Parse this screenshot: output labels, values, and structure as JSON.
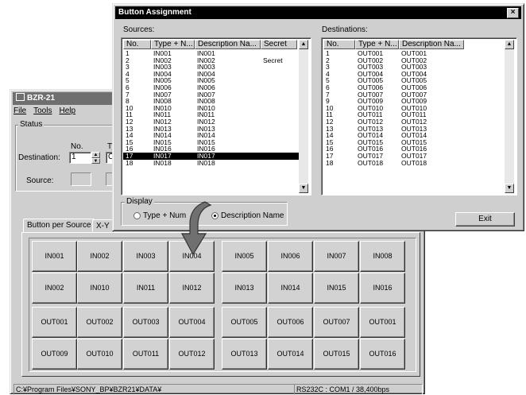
{
  "main_window": {
    "title": "BZR-21",
    "menu": [
      "File",
      "Tools",
      "Help"
    ],
    "status_group_label": "Status",
    "no_label": "No.",
    "type_label_partial": "Ty",
    "destination_label": "Destination:",
    "destination_value": "1",
    "type_value_partial": "C",
    "source_label": "Source:",
    "tabs": [
      "Button per Source",
      "X-Y"
    ],
    "button_rows": [
      [
        "IN001",
        "IN002",
        "IN003",
        "IN004",
        "IN005",
        "IN006",
        "IN007",
        "IN008"
      ],
      [
        "IN002",
        "IN010",
        "IN011",
        "IN012",
        "IN013",
        "IN014",
        "IN015",
        "IN016"
      ],
      [
        "OUT001",
        "OUT002",
        "OUT003",
        "OUT004",
        "OUT005",
        "OUT006",
        "OUT007",
        "OUT001"
      ],
      [
        "OUT009",
        "OUT010",
        "OUT011",
        "OUT012",
        "OUT013",
        "OUT014",
        "OUT015",
        "OUT016"
      ]
    ],
    "status_path": "C:¥Program Files¥SONY_BP¥BZR21¥DATA¥",
    "status_port": "RS232C : COM1 / 38,400bps"
  },
  "dialog": {
    "title": "Button Assignment",
    "close_label": "×",
    "sources_label": "Sources:",
    "destinations_label": "Destinations:",
    "sources_columns": [
      "No.",
      "Type + N...",
      "Description Na...",
      "Secret"
    ],
    "destinations_columns": [
      "No.",
      "Type + N...",
      "Description Na..."
    ],
    "sources_rows": [
      [
        "1",
        "IN001",
        "IN001",
        ""
      ],
      [
        "2",
        "IN002",
        "IN002",
        "Secret"
      ],
      [
        "3",
        "IN003",
        "IN003",
        ""
      ],
      [
        "4",
        "IN004",
        "IN004",
        ""
      ],
      [
        "5",
        "IN005",
        "IN005",
        ""
      ],
      [
        "6",
        "IN006",
        "IN006",
        ""
      ],
      [
        "7",
        "IN007",
        "IN007",
        ""
      ],
      [
        "8",
        "IN008",
        "IN008",
        ""
      ],
      [
        "10",
        "IN010",
        "IN010",
        ""
      ],
      [
        "11",
        "IN011",
        "IN011",
        ""
      ],
      [
        "12",
        "IN012",
        "IN012",
        ""
      ],
      [
        "13",
        "IN013",
        "IN013",
        ""
      ],
      [
        "14",
        "IN014",
        "IN014",
        ""
      ],
      [
        "15",
        "IN015",
        "IN015",
        ""
      ],
      [
        "16",
        "IN016",
        "IN016",
        ""
      ],
      [
        "17",
        "IN017",
        "IN017",
        ""
      ],
      [
        "18",
        "IN018",
        "IN018",
        ""
      ]
    ],
    "sources_selected_index": 15,
    "destinations_rows": [
      [
        "1",
        "OUT001",
        "OUT001"
      ],
      [
        "2",
        "OUT002",
        "OUT002"
      ],
      [
        "3",
        "OUT003",
        "OUT003"
      ],
      [
        "4",
        "OUT004",
        "OUT004"
      ],
      [
        "5",
        "OUT005",
        "OUT005"
      ],
      [
        "6",
        "OUT006",
        "OUT006"
      ],
      [
        "7",
        "OUT007",
        "OUT007"
      ],
      [
        "9",
        "OUT009",
        "OUT009"
      ],
      [
        "10",
        "OUT010",
        "OUT010"
      ],
      [
        "11",
        "OUT011",
        "OUT011"
      ],
      [
        "12",
        "OUT012",
        "OUT012"
      ],
      [
        "13",
        "OUT013",
        "OUT013"
      ],
      [
        "14",
        "OUT014",
        "OUT014"
      ],
      [
        "15",
        "OUT015",
        "OUT015"
      ],
      [
        "16",
        "OUT016",
        "OUT016"
      ],
      [
        "17",
        "OUT017",
        "OUT017"
      ],
      [
        "18",
        "OUT018",
        "OUT018"
      ]
    ],
    "display_group_label": "Display",
    "radio_type_label": "Type + Num",
    "radio_desc_label": "Description Name",
    "selected_display": "Description Name",
    "exit_label": "Exit"
  },
  "colors": {
    "arrow": "#707070",
    "window_bg": "#cfcfcf"
  }
}
